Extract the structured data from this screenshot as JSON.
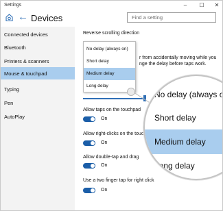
{
  "window": {
    "title": "Settings",
    "controls": {
      "minimize": "–",
      "maximize": "☐",
      "close": "✕"
    }
  },
  "header": {
    "page_title": "Devices",
    "search_placeholder": "Find a setting"
  },
  "sidebar": {
    "items": [
      {
        "label": "Connected devices",
        "selected": false
      },
      {
        "label": "Bluetooth",
        "selected": false
      },
      {
        "label": "Printers & scanners",
        "selected": false
      },
      {
        "label": "Mouse & touchpad",
        "selected": true
      },
      {
        "label": "Typing",
        "selected": false
      },
      {
        "label": "Pen",
        "selected": false
      },
      {
        "label": "AutoPlay",
        "selected": false
      }
    ]
  },
  "content": {
    "reverse_scrolling_label": "Reverse scrolling direction",
    "delay_text_line1": "r from accidentally moving while you",
    "delay_text_line2": "nge the delay before taps work.",
    "settings": [
      {
        "label": "Allow taps on the touchpad",
        "state": "On"
      },
      {
        "label": "Allow right-clicks on the touch",
        "state": "On"
      },
      {
        "label": "Allow double-tap and drag",
        "state": "On"
      },
      {
        "label": "Use a two finger tap for right click",
        "state": "On"
      }
    ]
  },
  "dropdown": {
    "options": [
      {
        "label": "No delay (always on)",
        "selected": false
      },
      {
        "label": "Short delay",
        "selected": false
      },
      {
        "label": "Medium delay",
        "selected": true
      },
      {
        "label": "Long delay",
        "selected": false
      }
    ]
  },
  "magnifier": {
    "options": [
      {
        "label": "No delay (always on)",
        "selected": false
      },
      {
        "label": "Short delay",
        "selected": false
      },
      {
        "label": "Medium delay",
        "selected": true
      },
      {
        "label": "Long delay",
        "selected": false
      }
    ]
  },
  "colors": {
    "accent": "#2f6fb6",
    "selection": "#a9cdee",
    "toggle_on": "#1b5ea8",
    "sidebar_bg": "#f3f3f3"
  }
}
